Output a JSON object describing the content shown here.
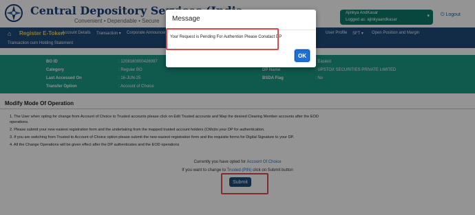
{
  "header": {
    "brand_title": "Central Depository Services (India",
    "tagline": "Convenient • Dependable • Secure",
    "user_name": "Ajinkya AndKasar",
    "user_logged_as": "Logged as: ajinkyaandkasar",
    "user_caret": "▾",
    "logout": "Logout",
    "logout_icon": "power-icon"
  },
  "nav": {
    "home_icon": "home-icon",
    "register": "Register E-Token",
    "items": [
      "Account Details",
      "Transaction ▾",
      "Corporate Announceme",
      "User Profile",
      "SFT ▾",
      "Open Position and Margin"
    ],
    "row2": "Transaction cum Holding Statement"
  },
  "info": {
    "labels": [
      "BO ID",
      "Category",
      "Last Accessed On",
      "Transfer Option"
    ],
    "values": [
      ": 1208160000426097",
      ": Regular BO",
      ": 16-JUN-25",
      ": Account of Choice"
    ],
    "right_labels": [
      "DP Name",
      "BSDA Flag"
    ],
    "right_values": [
      ": Easiest",
      ": UPSTOX SECURITIES PRIVATE LIMITED",
      ": No"
    ]
  },
  "section": {
    "title": "Modify Mode Of Operation",
    "rules": [
      "1. The User when opting for change from Account of Choice to Trusted accounts please click on Edit Trusted accounts and Map the desired Clearing Member accounts after the EOD",
      "operations.",
      "2. Please submit your new easiest registration form and the undertaking from the mapped trusted account holders (CMs)to your DP for authentication.",
      "3. If you are switching from Trusted to Account of Choice option please submit the new easiest registration form and the requisite forms for Digital Signature to your DP.",
      "4. All the Change Operations will be given effect after the DP authenticates and the EOD operations"
    ],
    "opted_prefix": "Currently you have opted for ",
    "opted_value": "Account Of Choice",
    "change_prefix": "If you want to change to ",
    "change_value": "Trusted (PIN)",
    "change_suffix": " click on Submit button",
    "submit": "Submit"
  },
  "modal": {
    "title": "Message",
    "message": "Your Request is Pending For Authention Please Conatact DP",
    "ok": "OK"
  },
  "colors": {
    "nav": "#1f4d7a",
    "info_band": "#1b9a86",
    "user_box": "#0f7a6a",
    "accent_yellow": "#f4d35e",
    "ok_button": "#1e70d4",
    "highlight_red": "#d94a4a"
  }
}
